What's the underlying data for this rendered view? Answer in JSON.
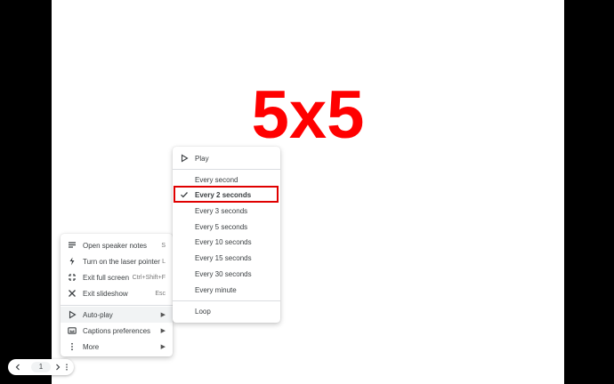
{
  "slide": {
    "title": "5x5",
    "title_color": "#ff0000"
  },
  "main_menu": {
    "items": [
      {
        "label": "Open speaker notes",
        "shortcut": "S",
        "icon": "notes-icon"
      },
      {
        "label": "Turn on the laser pointer",
        "shortcut": "L",
        "icon": "laser-pointer-icon"
      },
      {
        "label": "Exit full screen",
        "shortcut": "Ctrl+Shift+F",
        "icon": "exit-fullscreen-icon"
      },
      {
        "label": "Exit slideshow",
        "shortcut": "Esc",
        "icon": "close-icon"
      },
      {
        "label": "Auto-play",
        "icon": "play-icon",
        "submenu": true,
        "highlighted": true
      },
      {
        "label": "Captions preferences",
        "icon": "captions-icon",
        "submenu": true
      },
      {
        "label": "More",
        "icon": "more-vertical-icon",
        "submenu": true
      }
    ]
  },
  "autoplay_menu": {
    "play_label": "Play",
    "intervals": [
      "Every second",
      "Every 2 seconds",
      "Every 3 seconds",
      "Every 5 seconds",
      "Every 10 seconds",
      "Every 15 seconds",
      "Every 30 seconds",
      "Every minute"
    ],
    "selected": "Every 2 seconds",
    "loop_label": "Loop"
  },
  "nav": {
    "page": "1"
  },
  "colors": {
    "highlight": "#e00000",
    "menu_text": "#3c4043"
  }
}
